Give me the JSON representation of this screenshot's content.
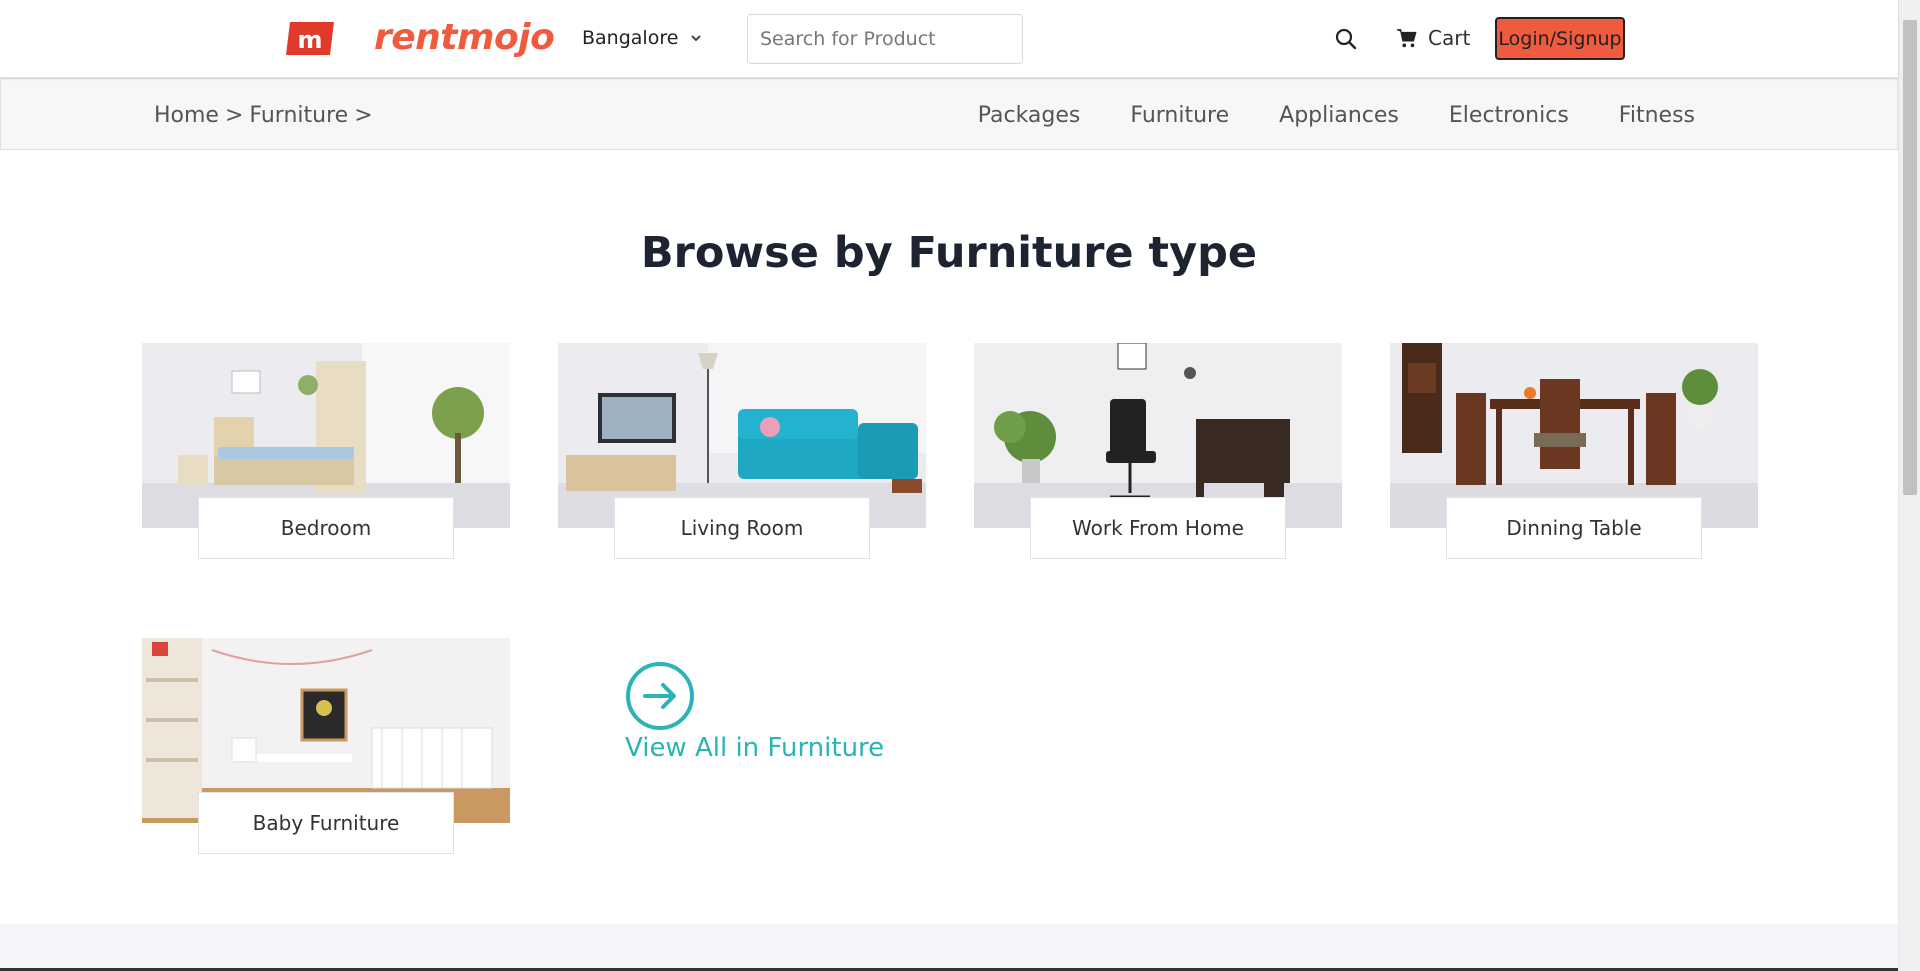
{
  "header": {
    "logo_letter": "m",
    "brand": "rentmojo",
    "city": "Bangalore",
    "search_placeholder": "Search for Product",
    "cart_label": "Cart",
    "login_label": "Login/Signup",
    "accent_color": "#f05a3f"
  },
  "breadcrumb": [
    "Home",
    ">",
    "Furniture",
    ">"
  ],
  "nav": [
    "Packages",
    "Furniture",
    "Appliances",
    "Electronics",
    "Fitness"
  ],
  "main": {
    "title": "Browse by Furniture type",
    "categories": [
      {
        "label": "Bedroom"
      },
      {
        "label": "Living Room"
      },
      {
        "label": "Work From Home"
      },
      {
        "label": "Dinning Table"
      },
      {
        "label": "Baby Furniture"
      }
    ],
    "view_all_label": "View All in Furniture",
    "view_all_color": "#2ab3b8"
  }
}
